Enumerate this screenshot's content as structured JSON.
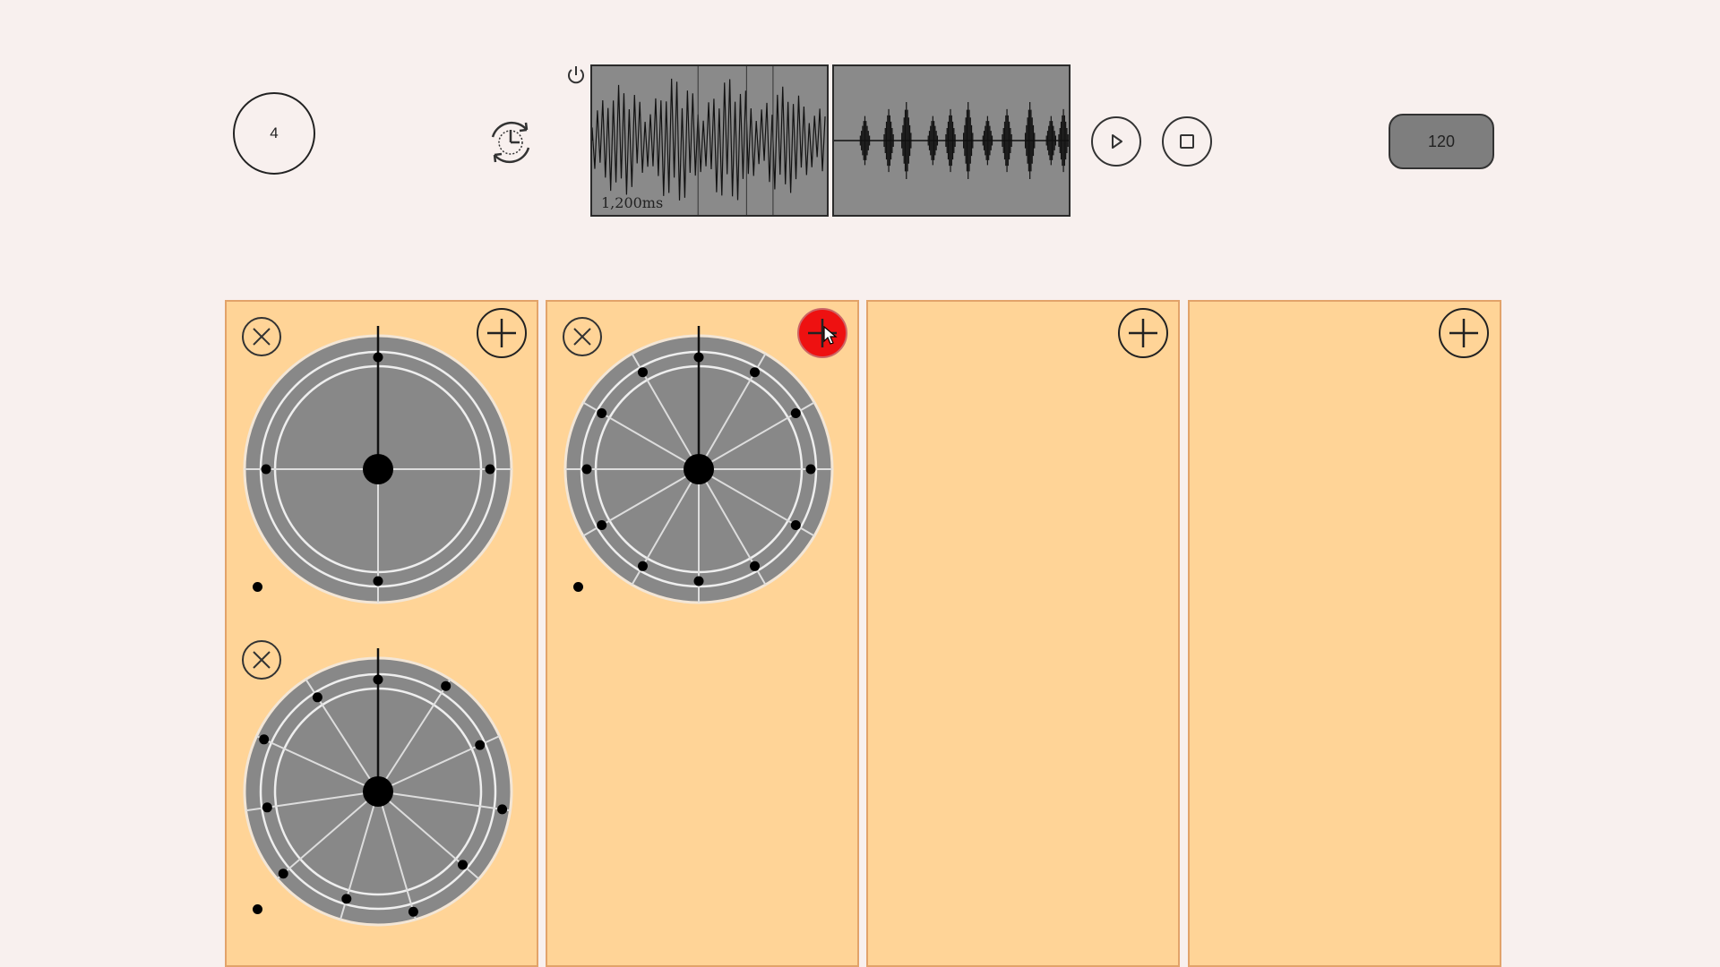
{
  "header": {
    "beats_value": "4",
    "sample_label": "1,200ms",
    "bpm_value": "120"
  },
  "icons": {
    "power": "power-icon",
    "sync": "sync-tempo-icon",
    "play": "play-icon",
    "stop": "stop-icon",
    "add": "plus-circle-icon",
    "remove": "x-circle-icon"
  },
  "colors": {
    "background": "#f8f0ee",
    "track": "#ffd497",
    "track_border": "#e2a36a",
    "wheel": "#888888",
    "active_add": "#ee1111"
  },
  "tracks": [
    {
      "name": "track-1",
      "rhythms": [
        {
          "steps": 4
        },
        {
          "steps": 11
        }
      ]
    },
    {
      "name": "track-2",
      "rhythms": [
        {
          "steps": 12
        }
      ]
    },
    {
      "name": "track-3",
      "rhythms": []
    },
    {
      "name": "track-4",
      "rhythms": []
    }
  ]
}
